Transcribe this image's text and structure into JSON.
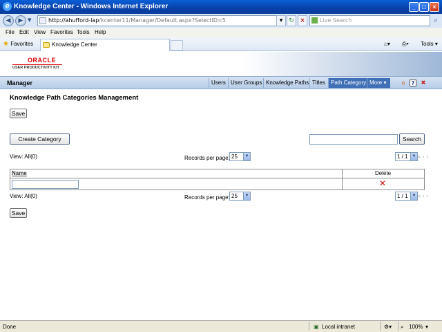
{
  "window": {
    "title": "Knowledge Center - Windows Internet Explorer",
    "minimize": "_",
    "maximize": "□",
    "close": "×"
  },
  "address": {
    "url_host": "http://ahufford-lap",
    "url_path": "/kcenter11/Manager/Default.aspx?SelectID=5",
    "search_placeholder": "Live Search"
  },
  "menu": [
    "File",
    "Edit",
    "View",
    "Favorites",
    "Tools",
    "Help"
  ],
  "favorites_bar": {
    "favorites_label": "Favorites",
    "tab_title": "Knowledge Center",
    "tools_label": "Tools"
  },
  "branding": {
    "logo": "ORACLE",
    "product": "USER PRODUCTIVITY KIT"
  },
  "manager_bar": {
    "title": "Manager",
    "tabs": [
      "Users",
      "User Groups",
      "Knowledge Paths",
      "Titles",
      "Path Category",
      "More"
    ],
    "active_tab": "Path Category",
    "icons": [
      "home-icon",
      "help-icon",
      "logout-icon"
    ]
  },
  "page": {
    "title": "Knowledge Path Categories Management",
    "save_label": "Save",
    "create_category_label": "Create Category",
    "search_button_label": "Search",
    "search_value": "",
    "view_all_top": "View: All(0)",
    "view_all_bottom": "View: All(0)",
    "records_per_page_label": "Records per page:",
    "records_per_page_value": "25",
    "page_indicator": "1 / 1",
    "pager_nav": "« ‹ ›"
  },
  "table": {
    "columns": [
      "Name",
      "Delete"
    ],
    "rows": [
      {
        "name": "",
        "delete_icon": "delete-x-icon"
      }
    ]
  },
  "status_bar": {
    "status": "Done",
    "zone": "Local intranet",
    "zoom": "100%"
  }
}
